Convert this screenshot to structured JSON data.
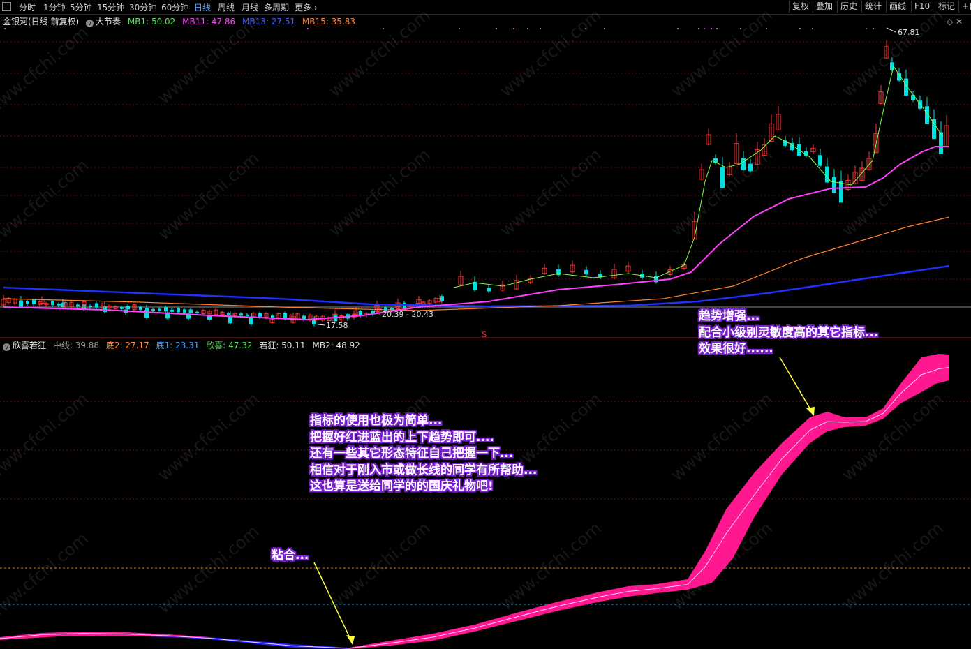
{
  "toolbar": {
    "periods": [
      "分时",
      "1分钟",
      "5分钟",
      "15分钟",
      "30分钟",
      "60分钟",
      "日线",
      "周线",
      "月线",
      "多周期",
      "更多"
    ],
    "active_period": "日线",
    "right_buttons": [
      "复权",
      "叠加",
      "历史",
      "统计",
      "画线",
      "F10",
      "标记",
      "+自"
    ]
  },
  "main_header": {
    "title": "金银河(日线 前复权)",
    "indicator": "大节奏",
    "mb1": "MB1: 50.02",
    "mb11": "MB11: 47.86",
    "mb13": "MB13: 27.51",
    "mb15": "MB15: 35.83"
  },
  "sub_header": {
    "name": "欣喜若狂",
    "zhongxian": "中线: 39.88",
    "di2": "底2: 27.17",
    "di1": "底1: 23.31",
    "xinxi": "欣喜: 47.32",
    "ruokuang": "若狂: 50.11",
    "mb2": "MB2: 48.92"
  },
  "price_labels": {
    "high": "67.81",
    "low": "17.58",
    "mid": "20.39 - 20.43",
    "marker": "$"
  },
  "annotations": {
    "trend": [
      "趋势增强...",
      "配合小级别灵敏度高的其它指标...",
      "效果很好......"
    ],
    "usage": [
      "指标的使用也极为简单...",
      "把握好红进蓝出的上下趋势即可....",
      "还有一些其它形态特征自己把握一下...",
      "相信对于刚入市或做长线的同学有所帮助...",
      "这也算是送给同学的的国庆礼物吧!"
    ],
    "sticky": "粘合..."
  },
  "watermark": "www.cfchi.com",
  "colors": {
    "up": "#ff3232",
    "down": "#00e0e0",
    "ma_green": "#80ff40",
    "ma_magenta": "#ff40ff",
    "ma_orange": "#ff8030",
    "ma_blue": "#2030ff",
    "band_pink": "#ff1890",
    "band_blue": "#2020ff",
    "grid_red": "#6a1010"
  }
}
